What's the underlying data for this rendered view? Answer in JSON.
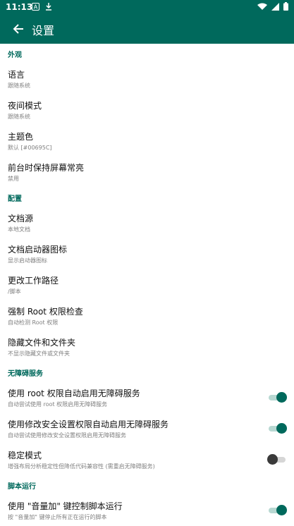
{
  "status": {
    "time": "11:13",
    "left_icons": [
      "notification-a-icon",
      "download-icon"
    ],
    "right_icons": [
      "wifi-icon",
      "signal-icon",
      "battery-icon"
    ]
  },
  "toolbar": {
    "title": "设置",
    "back_icon": "arrow-left-icon"
  },
  "sections": {
    "appearance": {
      "header": "外观",
      "language": {
        "title": "语言",
        "summary": "跟随系统"
      },
      "night_mode": {
        "title": "夜间模式",
        "summary": "跟随系统"
      },
      "theme_color": {
        "title": "主题色",
        "summary": "默认 [#00695C]"
      },
      "keep_screen_on": {
        "title": "前台时保持屏幕常亮",
        "summary": "禁用"
      }
    },
    "config": {
      "header": "配置",
      "doc_source": {
        "title": "文档源",
        "summary": "本地文档"
      },
      "doc_launcher_icon": {
        "title": "文档启动器图标",
        "summary": "显示启动器图标"
      },
      "working_dir": {
        "title": "更改工作路径",
        "summary": "/脚本"
      },
      "force_root": {
        "title": "强制 Root 权限检查",
        "summary": "自动检测 Root 权限"
      },
      "hidden_files": {
        "title": "隐藏文件和文件夹",
        "summary": "不显示隐藏文件或文件夹"
      }
    },
    "accessibility": {
      "header": "无障碍服务",
      "root_auto_enable": {
        "title": "使用 root 权限自动启用无障碍服务",
        "summary": "自动尝试使用 root 权限启用无障碍服务",
        "enabled": true
      },
      "secure_settings": {
        "title": "使用修改安全设置权限自动启用无障碍服务",
        "summary": "自动尝试使用修改安全设置权限启用无障碍服务",
        "enabled": true
      },
      "stable_mode": {
        "title": "稳定模式",
        "summary": "增强布局分析稳定性但降低代码兼容性 (需重启无障碍服务)",
        "enabled": false
      }
    },
    "script_run": {
      "header": "脚本运行",
      "volume_key": {
        "title": "使用 \"音量加\" 键控制脚本运行",
        "summary": "按 \"音量加\" 键停止所有正在运行的脚本",
        "enabled": true
      }
    }
  },
  "colors": {
    "primary": "#00695c",
    "track_on": "#b8d8d2",
    "track_off": "#d6d6d6",
    "thumb_off": "#3a3a3a"
  }
}
